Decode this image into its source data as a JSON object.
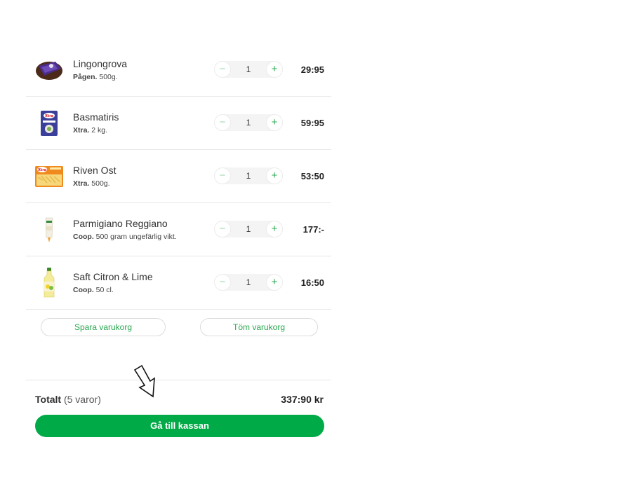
{
  "items": [
    {
      "name": "Lingongrova",
      "brand": "Pågen.",
      "size": "500g.",
      "qty": "1",
      "price": "29:95",
      "icon": "bread-package-icon"
    },
    {
      "name": "Basmatiris",
      "brand": "Xtra.",
      "size": "2 kg.",
      "qty": "1",
      "price": "59:95",
      "icon": "rice-bag-icon"
    },
    {
      "name": "Riven Ost",
      "brand": "Xtra.",
      "size": "500g.",
      "qty": "1",
      "price": "53:50",
      "icon": "grated-cheese-icon"
    },
    {
      "name": "Parmigiano Reggiano",
      "brand": "Coop.",
      "size": "500 gram ungefärlig vikt.",
      "qty": "1",
      "price": "177:-",
      "icon": "parmesan-icon"
    },
    {
      "name": "Saft Citron & Lime",
      "brand": "Coop.",
      "size": "50 cl.",
      "qty": "1",
      "price": "16:50",
      "icon": "juice-bottle-icon"
    }
  ],
  "stepper": {
    "minus": "−",
    "plus": "+"
  },
  "actions": {
    "save": "Spara varukorg",
    "empty": "Töm varukorg"
  },
  "summary": {
    "total_label": "Totalt",
    "total_count": "(5 varor)",
    "total_amount": "337:90 kr"
  },
  "checkout_label": "Gå till kassan",
  "colors": {
    "accent": "#00aa46",
    "accent_text": "#2aa84f"
  }
}
